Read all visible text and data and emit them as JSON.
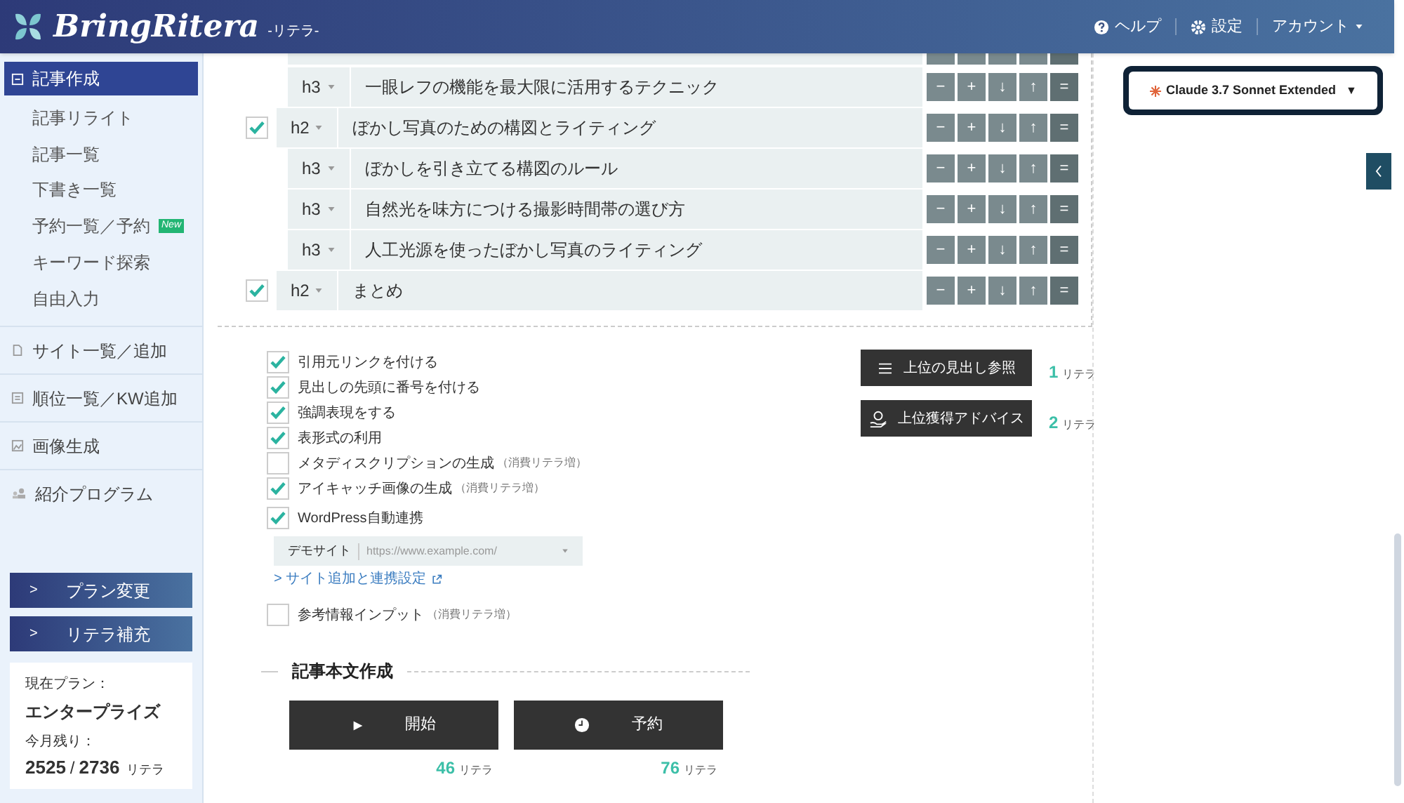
{
  "header": {
    "logo": "BringRitera",
    "logo_sub": "-リテラ-",
    "nav": [
      {
        "kind": "help",
        "label": "ヘルプ"
      },
      {
        "kind": "settings",
        "label": "設定"
      },
      {
        "kind": "account",
        "label": "アカウント"
      }
    ]
  },
  "sidebar": {
    "items": [
      {
        "kind": "compose",
        "label": "記事作成",
        "selected": true,
        "children": [
          {
            "label": "記事リライト",
            "selected": false
          },
          {
            "label": "記事一覧",
            "selected": false
          },
          {
            "label": "下書き一覧",
            "selected": false
          },
          {
            "label": "予約一覧／予約",
            "selected": false,
            "badge": "New"
          },
          {
            "label": "キーワード探索",
            "selected": false
          },
          {
            "label": "自由入力",
            "selected": false
          }
        ]
      },
      {
        "kind": "sites",
        "label": "サイト一覧／追加",
        "selected": false
      },
      {
        "kind": "ranking",
        "label": "順位一覧／KW追加",
        "selected": false
      },
      {
        "kind": "images",
        "label": "画像生成",
        "selected": false
      },
      {
        "kind": "referral",
        "label": "紹介プログラム",
        "selected": false
      }
    ],
    "buttons": [
      {
        "arrow": ">",
        "label": "プラン変更"
      },
      {
        "arrow": ">",
        "label": "リテラ補充"
      }
    ],
    "plan": {
      "plan_label": "現在プラン：",
      "plan_name": "エンタープライズ",
      "remaining_label": "今月残り：",
      "remaining": "2525",
      "separator": "/",
      "total": "2736",
      "unit": "リテラ"
    }
  },
  "outline": {
    "items": [
      {
        "level": "h3",
        "text": "一眼レフの機能を最大限に活用するテクニック",
        "buttons": [
          "−",
          "+",
          "↓",
          "↑",
          "="
        ]
      },
      {
        "level": "h2",
        "checked": true,
        "text": "ぼかし写真のための構図とライティング",
        "buttons": [
          "−",
          "+",
          "↓",
          "↑",
          "="
        ],
        "children": [
          {
            "level": "h3",
            "text": "ぼかしを引き立てる構図のルール",
            "buttons": [
              "−",
              "+",
              "↓",
              "↑",
              "="
            ]
          },
          {
            "level": "h3",
            "text": "自然光を味方につける撮影時間帯の選び方",
            "buttons": [
              "−",
              "+",
              "↓",
              "↑",
              "="
            ]
          },
          {
            "level": "h3",
            "text": "人工光源を使ったぼかし写真のライティング",
            "buttons": [
              "−",
              "+",
              "↓",
              "↑",
              "="
            ]
          }
        ]
      },
      {
        "level": "h2",
        "checked": true,
        "text": "まとめ",
        "buttons": [
          "−",
          "+",
          "↓",
          "↑",
          "="
        ]
      }
    ]
  },
  "options": [
    {
      "label": "引用元リンクを付ける",
      "checked": true
    },
    {
      "label": "見出しの先頭に番号を付ける",
      "checked": true
    },
    {
      "label": "強調表現をする",
      "checked": true
    },
    {
      "label": "表形式の利用",
      "checked": true
    },
    {
      "label": "メタディスクリプションの生成",
      "note": "（消費リテラ増）",
      "checked": false
    },
    {
      "label": "アイキャッチ画像の生成",
      "note": "（消費リテラ増）",
      "checked": true
    },
    {
      "label": "WordPress自動連携",
      "checked": true
    }
  ],
  "wordpress": {
    "site": "デモサイト",
    "url": "https://www.example.com/",
    "link": "> サイト追加と連携設定"
  },
  "reference_input": {
    "label": "参考情報インプット",
    "note": "（消費リテラ増）",
    "checked": false
  },
  "side_actions": [
    {
      "kind": "list",
      "label": "上位の見出し参照",
      "cost": "1",
      "unit": "リテラ"
    },
    {
      "kind": "advice",
      "label": "上位獲得アドバイス",
      "cost": "2",
      "unit": "リテラ"
    }
  ],
  "body_section": {
    "title": "記事本文作成",
    "actions": [
      {
        "kind": "start",
        "label": "開始",
        "cost": "46",
        "unit": "リテラ"
      },
      {
        "kind": "schedule",
        "label": "予約",
        "cost": "76",
        "unit": "リテラ"
      }
    ]
  },
  "model_select": {
    "label": "Claude 3.7 Sonnet Extended",
    "caret": "▼"
  }
}
